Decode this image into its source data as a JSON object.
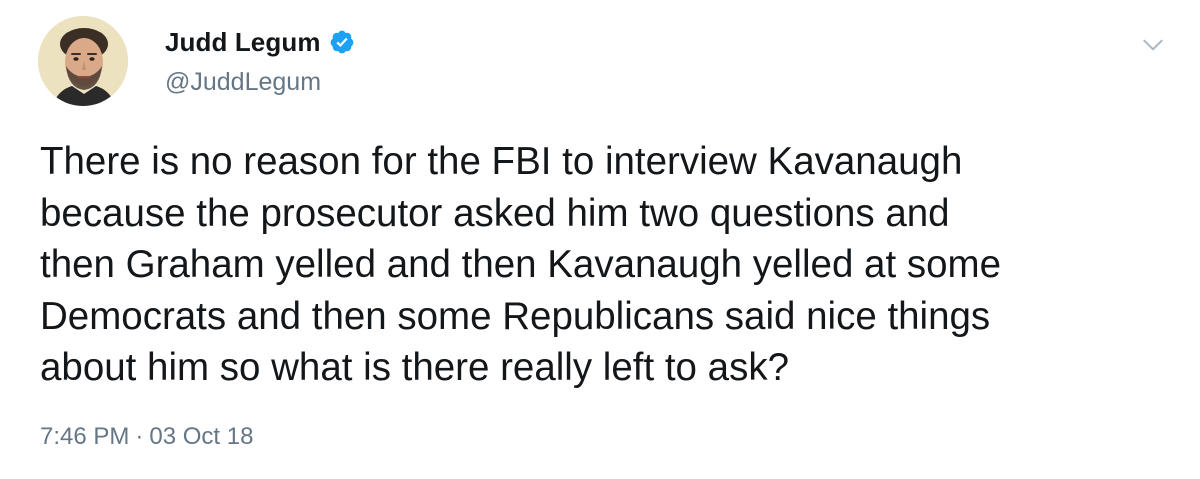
{
  "author": {
    "display_name": "Judd Legum",
    "handle": "@JuddLegum",
    "verified": true,
    "verified_icon": "verified-badge-icon",
    "verified_color": "#1da1f2"
  },
  "tweet": {
    "text": "There is no reason for the FBI to interview Kavanaugh\nbecause the prosecutor asked him two questions and\nthen Graham yelled and then Kavanaugh yelled at some\nDemocrats and then some Republicans said nice things\nabout him so what is there really left to ask?",
    "time": "7:46 PM",
    "separator": "·",
    "date": "03 Oct 18"
  },
  "controls": {
    "menu_icon": "chevron-down-icon"
  },
  "colors": {
    "text": "#14171a",
    "secondary_text": "#657786",
    "accent": "#1da1f2",
    "background": "#ffffff"
  }
}
